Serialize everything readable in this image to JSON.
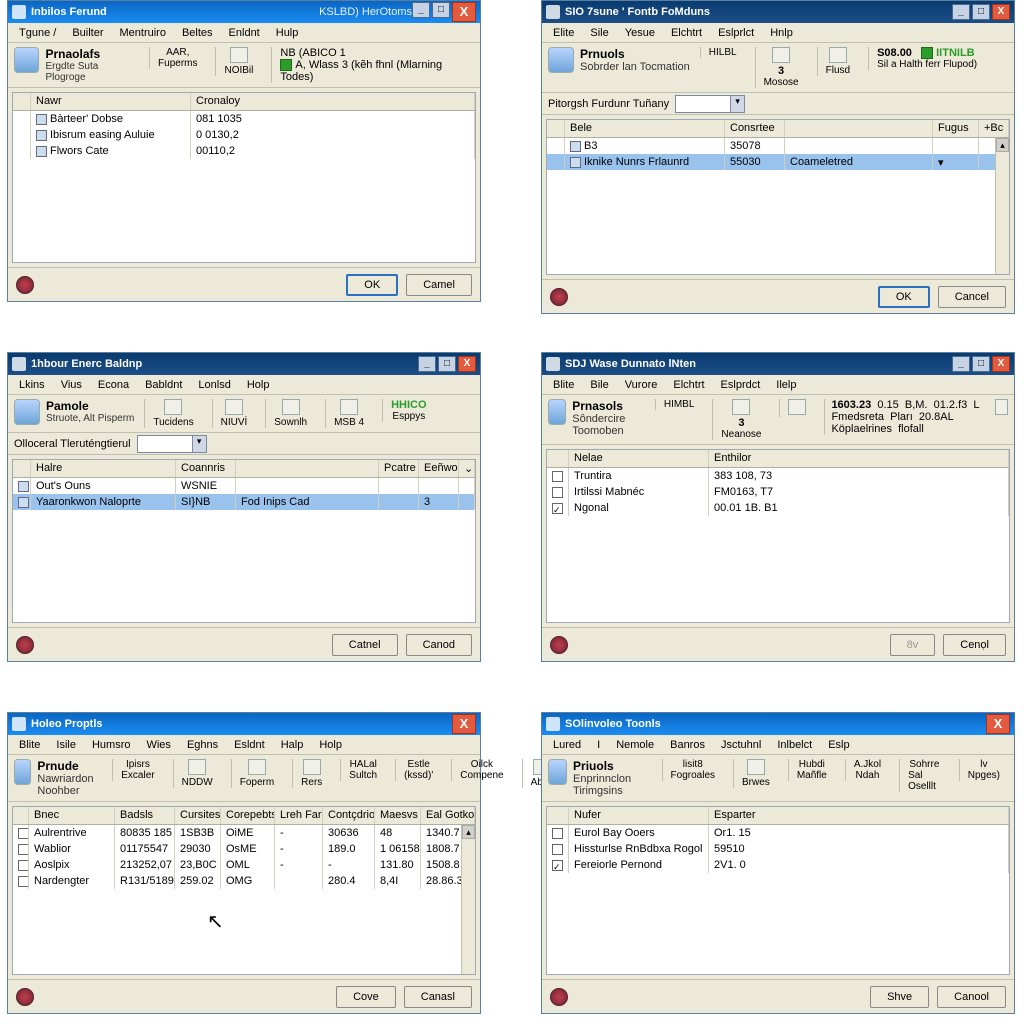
{
  "windows": {
    "w1": {
      "title": "Inbilos Ferund",
      "title_extra": "KSLBD) HerOtoms",
      "menu": [
        "Tgune /",
        "Builter",
        "Mentruiro",
        "Beltes",
        "Enldnt",
        "Hulp"
      ],
      "tool": {
        "title": "Prnaolafs",
        "sub": "Ergdte Suta Plogroge",
        "g1a": "AAR,",
        "g1b": "Fuperms",
        "g2a": "",
        "g2b": "NOIBil",
        "g3t": "NB (ABICO 1",
        "g3b": "A, Wlass  3",
        "g3c": "(kẽh fhnl (Mlarning Todes)"
      },
      "cols": {
        "c0": "",
        "c1": "Nawr",
        "c2": "Cronaloy"
      },
      "rows": [
        {
          "c1": "Bàrteer' Dobse",
          "c2": "081 1035"
        },
        {
          "c1": "Ibisrum  easing Auluie",
          "c2": "0 0130,2"
        },
        {
          "c1": "Flwors Cate",
          "c2": "00110,2"
        }
      ],
      "ok": "OK",
      "cancel": "Camel"
    },
    "w2": {
      "title": "SIO  7sune ' Fontb FoMduns",
      "menu": [
        "Elite",
        "Sile",
        "Yesue",
        "Elchtrt",
        "Eslprlct",
        "Hnlp"
      ],
      "tool": {
        "title": "Prnuols",
        "sub": "Sobrder lan",
        "s2": "Tocmation",
        "g1": "HILBL",
        "g2": "3",
        "g2b": "Mosose",
        "g3": "Flusd",
        "g4": "S08.00",
        "g4b": "Sil a Halth ferr Flupod)",
        "g5": "IITNILB"
      },
      "subbar": "Pitorgsh Furdunr Tuñany",
      "cols": {
        "c0": "",
        "c1": "Bele",
        "c2": "Consrtee",
        "c3": "",
        "c4": "Fugus",
        "c5": "+Bc"
      },
      "rows": [
        {
          "c1": "B3",
          "c2": "35078",
          "c3": ""
        },
        {
          "c1": "Iknike Nunrs Frlaunrd",
          "c2": "55030",
          "c3": "Coameletred",
          "sel": true
        }
      ],
      "ok": "OK",
      "cancel": "Cancel"
    },
    "w3": {
      "title": "1hbour Enerc Baldnp",
      "menu": [
        "Lkins",
        "Vius",
        "Econa",
        "Babldnt",
        "Lonlsd",
        "Holp"
      ],
      "tool": {
        "title": "Pamole",
        "sub": "Struote, Alt Pisperm",
        "g1": "Tucidens",
        "g2": "NIUVİ",
        "g3": "Sownlh",
        "g4": "MSB 4",
        "g5": "HHICO",
        "g5b": "Esppys"
      },
      "subbar": "Olloceral Tleruténgtierul",
      "cols": {
        "c0": "",
        "c1": "Halre",
        "c2": "Coannris",
        "c3": "",
        "c4": "Pcatre",
        "c5": "Eeñwol",
        "c6": "⌄"
      },
      "rows": [
        {
          "c1": "Out's Ouns",
          "c2": "WSNIE"
        },
        {
          "c1": "Yaaronkwon Naloprte",
          "c2": "SI}NB",
          "c3": "Fod Inips Cad",
          "c5": "3",
          "sel": true
        }
      ],
      "catnel": "Catnel",
      "cancel": "Canod"
    },
    "w4": {
      "title": "SDJ  Wase Dunnato lNten",
      "menu": [
        "Blite",
        "Bile",
        "Vurore",
        "Elchtrt",
        "Eslprdct",
        "Ilelp"
      ],
      "tool": {
        "title": "Prnasols",
        "sub": "Sôndercire",
        "s2": "Toomoben",
        "g1": "HIMBL",
        "g2": "3",
        "g2b": "Neanose",
        "stats": [
          "1603.23",
          "0.15",
          "B,M.",
          "01.2.f3",
          "L"
        ],
        "stats2": [
          "Fmedsreta",
          "Pları",
          "20.8AL",
          "Köplaelrines",
          "flofall"
        ]
      },
      "cols": {
        "c0": "",
        "c1": "Nelae",
        "c2": "Enthilor"
      },
      "rows": [
        {
          "c1": "Truntira",
          "c2": "383 108, 73"
        },
        {
          "c1": "Irtilssi Mabnéc",
          "c2": "FM0163, T7"
        },
        {
          "c1": "Ngonal",
          "c2": "00.01 1B. B1",
          "chk": true
        }
      ],
      "ok": "8v",
      "cancel": "Cenọl"
    },
    "w5": {
      "title": "Holeo Proptls",
      "menu": [
        "Blite",
        "Isile",
        "Humsro",
        "Wies",
        "Eghns",
        "Esldnt",
        "Halp",
        "Holp"
      ],
      "tool": {
        "title": "Prnude",
        "sub": "Nawriardon",
        "s2": "Noohber",
        "groups": [
          [
            "Ipisrs",
            "Excaler"
          ],
          [
            "",
            "NDDW"
          ],
          [
            "",
            "Foperm"
          ],
          [
            "",
            "Rers"
          ],
          [
            "HALal",
            "Sultch"
          ],
          [
            "Estle",
            "(kssd)'"
          ],
          [
            "Oilck",
            "Compene"
          ],
          [
            "",
            "Abye"
          ]
        ]
      },
      "cols": {
        "c0": "",
        "c1": "Bnec",
        "c2": "Badsls",
        "c3": "Cursitesl",
        "c4": "Corepebts",
        "c5": "Lreh Fars",
        "c6": "Contçdrion",
        "c7": "Maesvs *",
        "c8": "Eal Gotko"
      },
      "rows": [
        {
          "c1": "Aulrentrive",
          "c2": "80835 185",
          "c3": "1SB3B",
          "c4": "OiME",
          "c5": "-",
          "c6": "30636",
          "c7": "48",
          "c8": "1340.7"
        },
        {
          "c1": "Wablior",
          "c2": "01175547",
          "c3": "29030",
          "c4": "OsME",
          "c5": "-",
          "c6": "189.0",
          "c7": "1 06158",
          "c8": "1808.7"
        },
        {
          "c1": "Aoslpix",
          "c2": "213252,07",
          "c3": "23,B0C",
          "c4": "OML",
          "c5": "-",
          "c6": "-",
          "c7": "131.80",
          "c8": "1508.8"
        },
        {
          "c1": "Nardengter",
          "c2": "R131/5189",
          "c3": "259.02",
          "c4": "OMG",
          "c5": "",
          "c6": "280.4",
          "c7": "8,4I",
          "c8": "28.86.3"
        }
      ],
      "ok": "Cove",
      "cancel": "Canasl"
    },
    "w6": {
      "title": "SOlinvoleo Toonls",
      "menu": [
        "Lured",
        "I",
        "Nemole",
        "Banros",
        "Jsctuhnl",
        "Inlbelct",
        "Eslp"
      ],
      "tool": {
        "title": "Priuols",
        "sub": "Enprinnclon",
        "s2": "Tirimgsins",
        "groups": [
          [
            "lisit8",
            "Fogroales"
          ],
          [
            "",
            "Brwes"
          ],
          [
            "Hubdi",
            "Mañfle"
          ],
          [
            "A.Jkol",
            "Ndah"
          ],
          [
            "Sohrre",
            "Sal Oselllt"
          ],
          [
            "lv",
            "Npges)"
          ]
        ]
      },
      "cols": {
        "c0": "",
        "c1": "Nufer",
        "c2": "Esparter"
      },
      "rows": [
        {
          "c1": "Eurol Bay Ooers",
          "c2": "Or1. 15"
        },
        {
          "c1": "Hissturlse RnBdbxa Rogol",
          "c2": "59510"
        },
        {
          "c1": "Fereiorle Pernond",
          "c2": "2V1. 0",
          "chk": true
        }
      ],
      "ok": "Shve",
      "cancel": "Canool"
    }
  }
}
